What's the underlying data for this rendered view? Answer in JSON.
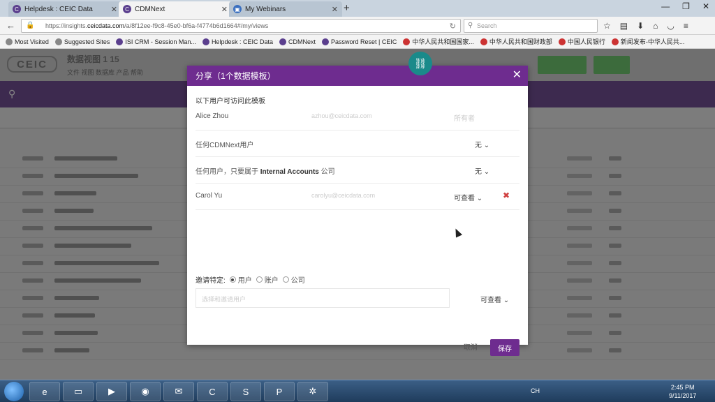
{
  "browser": {
    "tabs": [
      {
        "title": "Helpdesk : CEIC Data",
        "icon": "ceic-favicon",
        "active": false
      },
      {
        "title": "CDMNext",
        "icon": "ceic-favicon",
        "active": true
      },
      {
        "title": "My Webinars",
        "icon": "webinar-favicon",
        "active": false
      }
    ],
    "url": {
      "pre": "https://insights.",
      "domain": "ceicdata.com",
      "post": "/a/8f12ee-f9c8-45e0-bf6a-f4774b6d1664#/my/views"
    },
    "search_placeholder": "Search",
    "bookmarks": [
      "Most Visited",
      "Suggested Sites",
      "ISI CRM - Session Man...",
      "Helpdesk : CEIC Data",
      "CDMNext",
      "Password Reset | CEIC",
      "中华人民共和国国家...",
      "中华人民共和国财政部",
      "中国人民银行",
      "新闻发布-中华人民共..."
    ]
  },
  "app": {
    "logo": "CEIC",
    "title": "数据视图 1 15",
    "menu": "文件  视图  数据库  产品  帮助"
  },
  "modal": {
    "title": "分享（1个数据模板）",
    "section_title": "以下用户可访问此模板",
    "users": [
      {
        "name": "Alice Zhou",
        "email": "azhou@ceicdata.com",
        "permission": "所有者",
        "muted": true,
        "deletable": false
      },
      {
        "name": "任何CDMNext用户",
        "email": "",
        "permission": "无 ⌄",
        "muted": false,
        "deletable": false
      },
      {
        "name_pre": "任何用户，只要属于 ",
        "name_bold": "Internal Accounts",
        "name_post": " 公司",
        "email": "",
        "permission": "无 ⌄",
        "muted": false,
        "deletable": false
      },
      {
        "name": "Carol Yu",
        "email": "carolyu@ceicdata.com",
        "permission": "可查看 ⌄",
        "muted": false,
        "deletable": true
      }
    ],
    "invite_label": "邀请特定:",
    "invite_options": [
      {
        "label": "用户",
        "selected": true
      },
      {
        "label": "账户",
        "selected": false
      },
      {
        "label": "公司",
        "selected": false
      }
    ],
    "invite_placeholder": "选择和邀请用户",
    "invite_permission": "可查看 ⌄",
    "cancel_label": "取消",
    "save_label": "保存"
  },
  "taskbar": {
    "lang": "CH",
    "time": "2:45 PM",
    "date": "9/11/2017"
  },
  "colors": {
    "modal_header": "#6e2c8f",
    "delete_icon": "#d04040",
    "fab": "#1a8a8a"
  }
}
